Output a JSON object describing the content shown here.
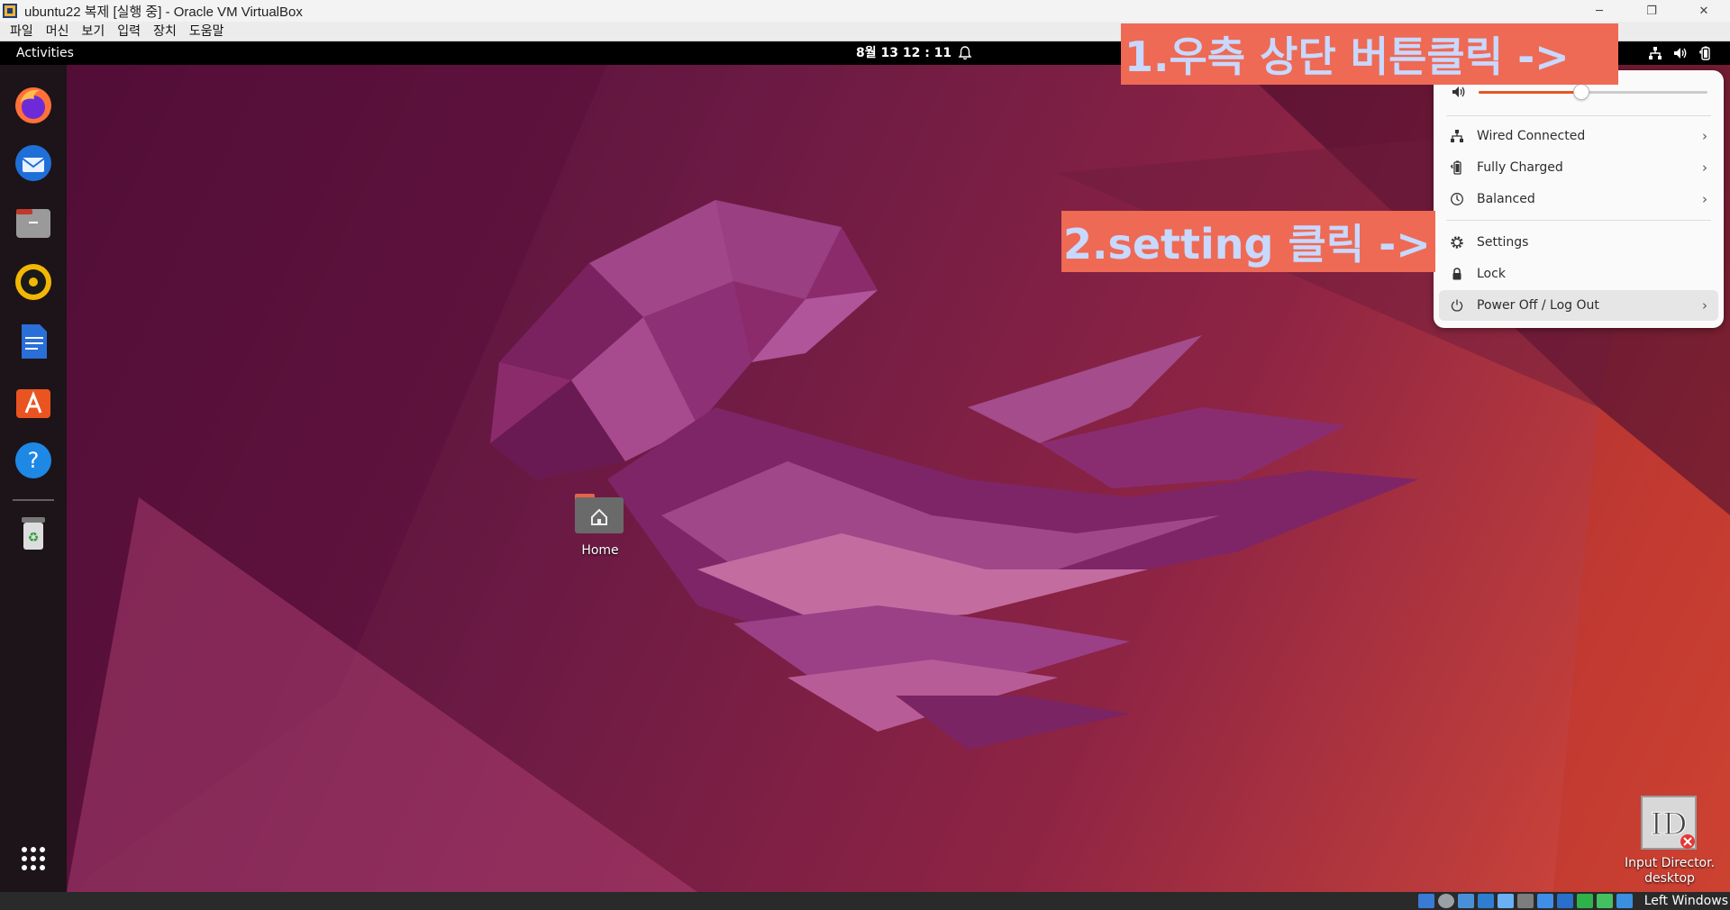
{
  "window": {
    "title": "ubuntu22 복제 [실행 중] - Oracle VM VirtualBox",
    "minimize": "─",
    "maximize": "❐",
    "close": "✕"
  },
  "vbox_menu": [
    "파일",
    "머신",
    "보기",
    "입력",
    "장치",
    "도움말"
  ],
  "gnome": {
    "activities": "Activities",
    "clock": "8월 13  12 : 11"
  },
  "dock": {
    "apps": [
      "firefox-icon",
      "thunderbird-icon",
      "files-icon",
      "rhythmbox-icon",
      "libreoffice-writer-icon",
      "app-center-icon",
      "help-icon",
      "trash-icon",
      "show-apps-icon"
    ]
  },
  "desktop": {
    "home_label": "Home",
    "input_director_label": "Input Director.\ndesktop"
  },
  "quick_settings": {
    "volume_level": 0.45,
    "items": [
      {
        "label": "Wired Connected",
        "icon": "network-icon",
        "has_submenu": true
      },
      {
        "label": "Fully Charged",
        "icon": "battery-icon",
        "has_submenu": true
      },
      {
        "label": "Balanced",
        "icon": "power-profile-icon",
        "has_submenu": true
      },
      {
        "label": "Settings",
        "icon": "gear-icon",
        "has_submenu": false
      },
      {
        "label": "Lock",
        "icon": "lock-icon",
        "has_submenu": false
      },
      {
        "label": "Power Off / Log Out",
        "icon": "power-icon",
        "has_submenu": true
      }
    ],
    "chevron": "›"
  },
  "annotations": {
    "step1": "1.우측 상단 버튼클릭 ->",
    "step2": "2.setting   클릭 ->"
  },
  "statusbar": {
    "host_key": "Left Windows"
  },
  "colors": {
    "accent": "#e95420",
    "annotation_bg": "#ee6a54",
    "annotation_text": "#c8d8ff"
  }
}
